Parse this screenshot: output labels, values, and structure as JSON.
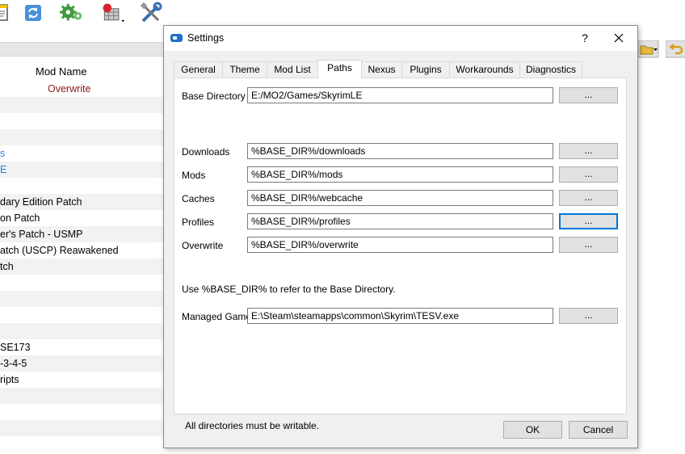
{
  "toolbar": {
    "icons": [
      "document-icon",
      "refresh-icon",
      "gears-icon",
      "executables-icon",
      "tools-icon"
    ]
  },
  "modlist": {
    "header": "Mod Name",
    "rows": [
      {
        "text": "Overwrite"
      },
      {
        "text": ""
      },
      {
        "text": ""
      },
      {
        "text": ""
      },
      {
        "text": "s"
      },
      {
        "text": "E"
      },
      {
        "text": ""
      },
      {
        "text": "dary Edition Patch"
      },
      {
        "text": "on Patch"
      },
      {
        "text": "er's Patch - USMP"
      },
      {
        "text": "atch (USCP) Reawakened"
      },
      {
        "text": "tch"
      },
      {
        "text": ""
      },
      {
        "text": ""
      },
      {
        "text": ""
      },
      {
        "text": ""
      },
      {
        "text": "SE173"
      },
      {
        "text": "-3-4-5"
      },
      {
        "text": "ripts"
      },
      {
        "text": ""
      },
      {
        "text": ""
      },
      {
        "text": ""
      },
      {
        "text": ""
      }
    ]
  },
  "dialog": {
    "title": "Settings",
    "help": "?",
    "tabs": [
      "General",
      "Theme",
      "Mod List",
      "Paths",
      "Nexus",
      "Plugins",
      "Workarounds",
      "Diagnostics"
    ],
    "active_tab": "Paths",
    "paths": {
      "base_directory": {
        "label": "Base Directory",
        "value": "E:/MO2/Games/SkyrimLE"
      },
      "downloads": {
        "label": "Downloads",
        "value": "%BASE_DIR%/downloads"
      },
      "mods": {
        "label": "Mods",
        "value": "%BASE_DIR%/mods"
      },
      "caches": {
        "label": "Caches",
        "value": "%BASE_DIR%/webcache"
      },
      "profiles": {
        "label": "Profiles",
        "value": "%BASE_DIR%/profiles"
      },
      "overwrite": {
        "label": "Overwrite",
        "value": "%BASE_DIR%/overwrite"
      },
      "managed_game": {
        "label": "Managed Game",
        "value": "E:\\Steam\\steamapps\\common\\Skyrim\\TESV.exe"
      }
    },
    "browse_label": "...",
    "hint": "Use %BASE_DIR% to refer to the Base Directory.",
    "footnote": "All directories must be writable.",
    "ok_label": "OK",
    "cancel_label": "Cancel"
  },
  "colors": {
    "accent": "#0078d7",
    "overwrite_text": "#8b1a1a",
    "link_blue": "#2a7fd4"
  }
}
